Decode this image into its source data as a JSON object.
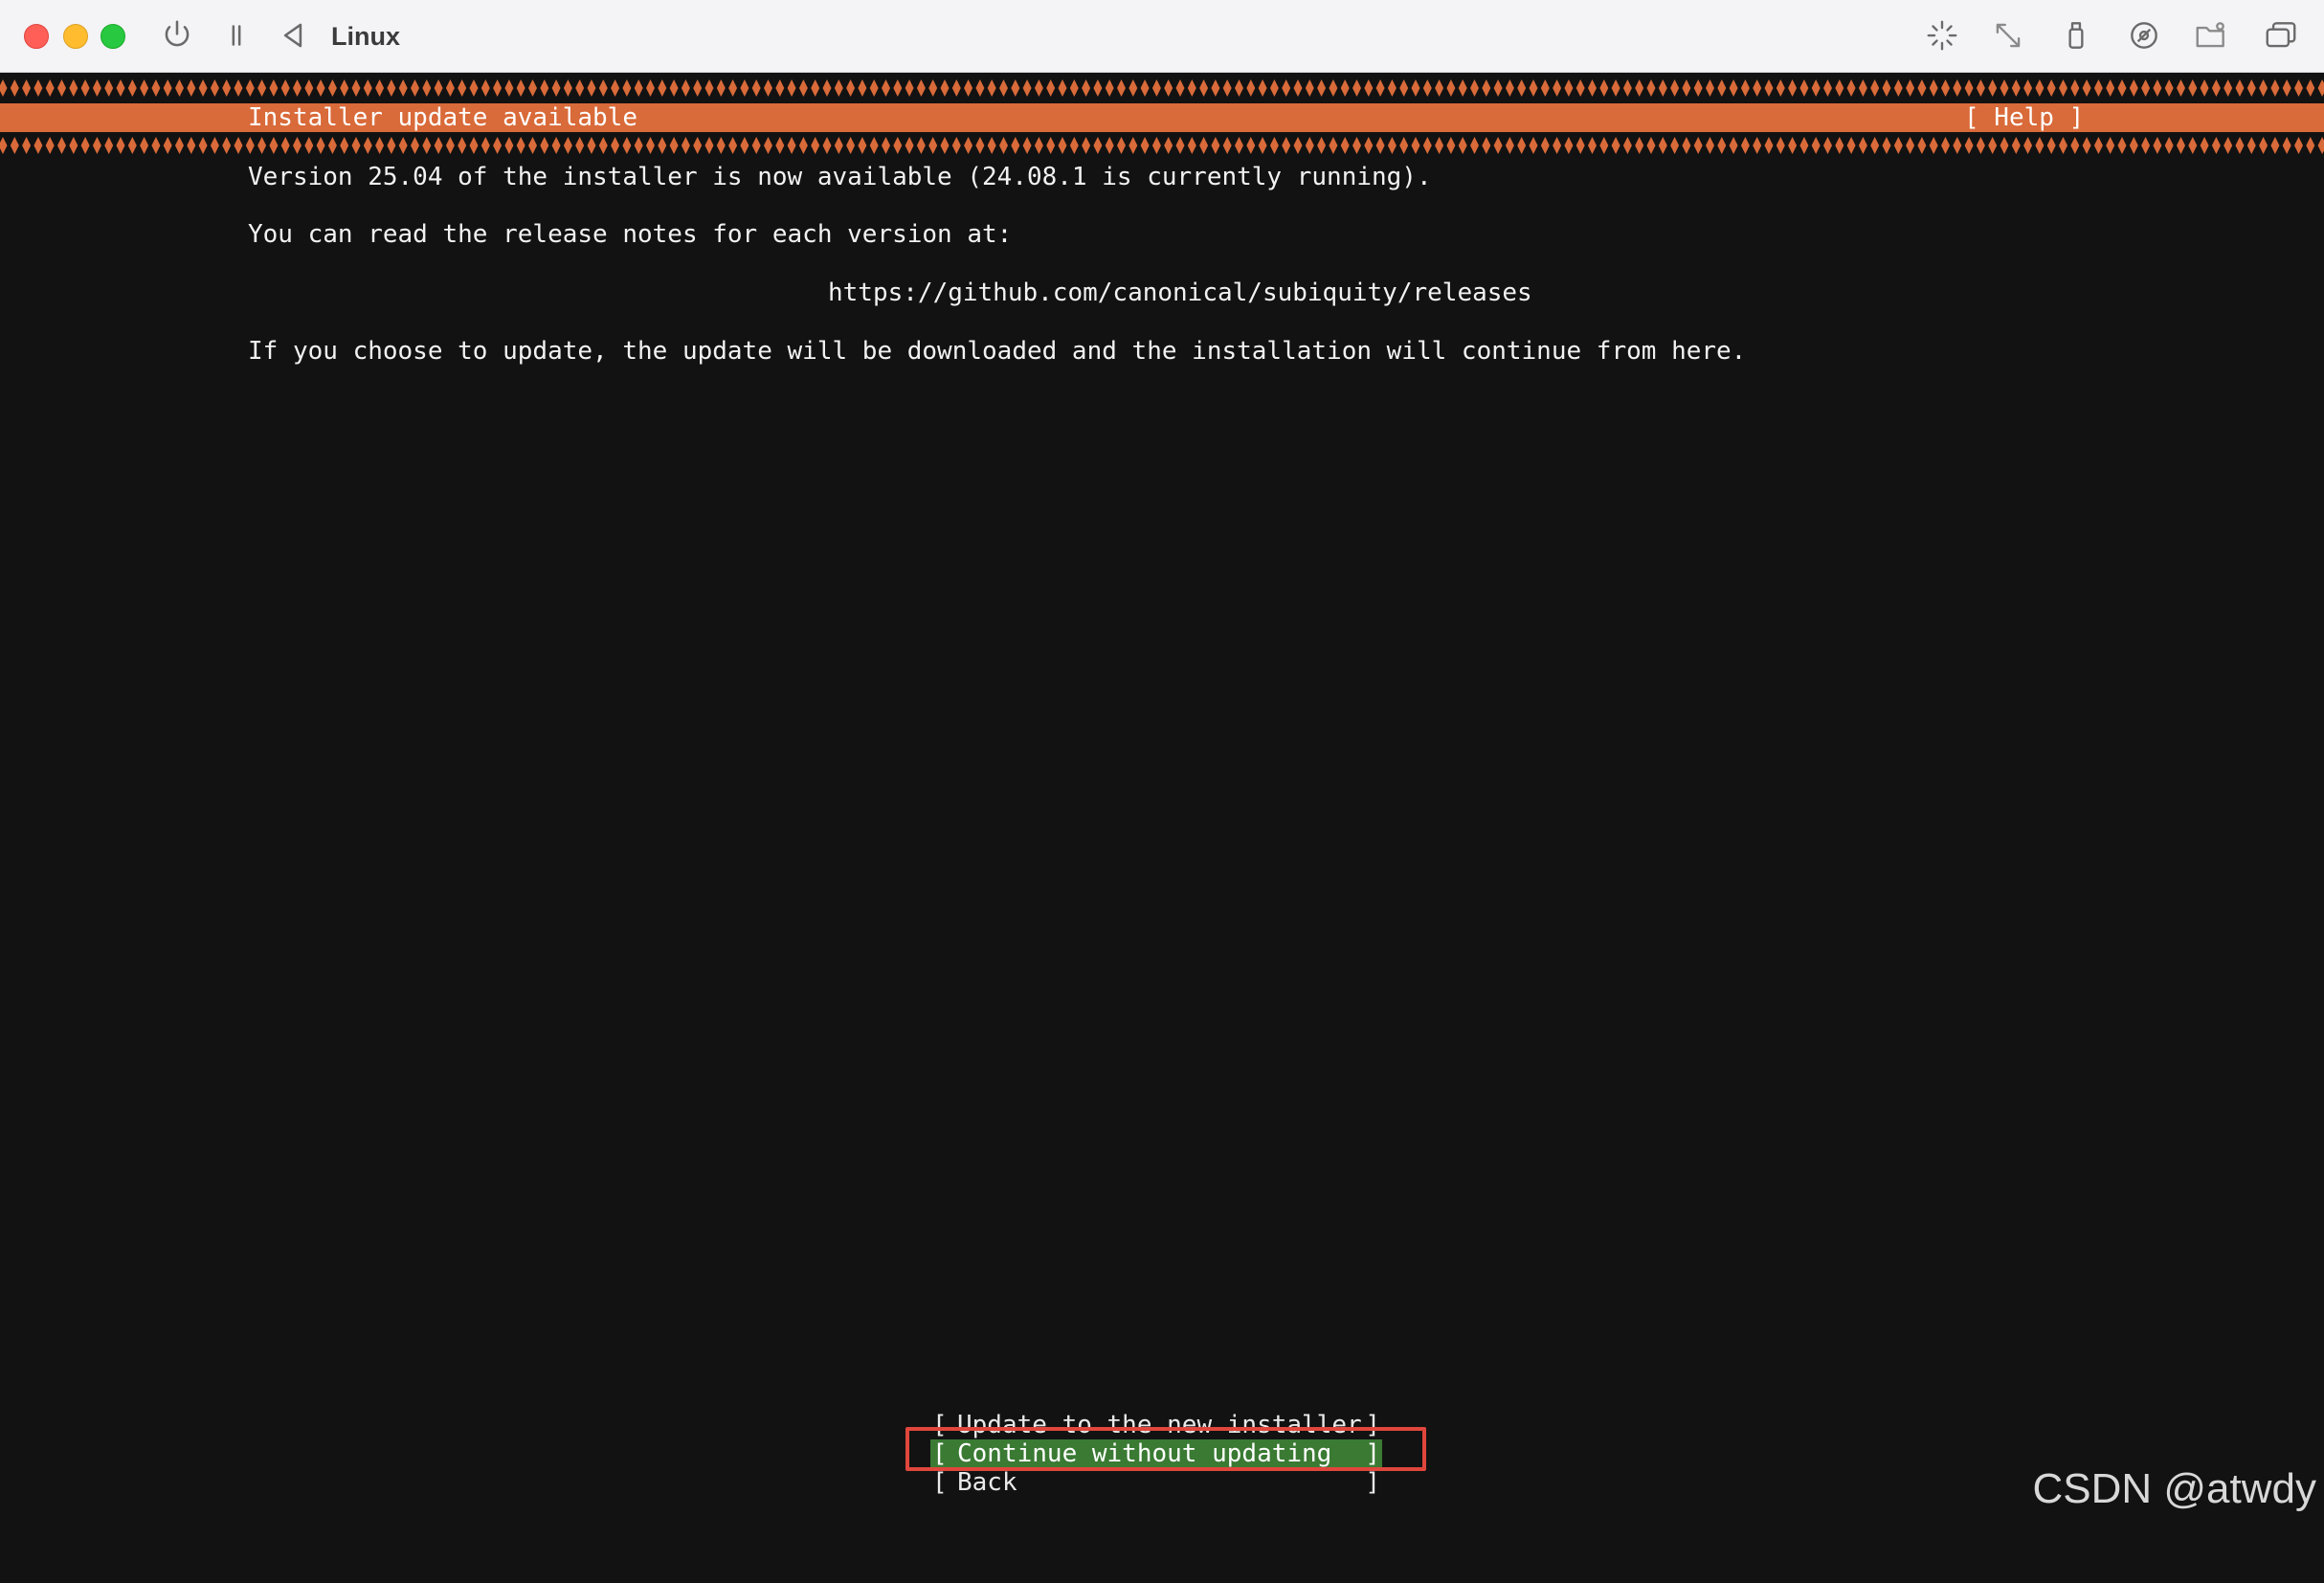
{
  "window": {
    "title": "Linux",
    "toolbar_icons": [
      "power-icon",
      "pause-icon",
      "back-icon",
      "cursor-capture-icon",
      "resize-icon",
      "usb-icon",
      "disc-icon",
      "shared-folder-icon",
      "windows-icon"
    ]
  },
  "installer": {
    "header_title": "Installer update available",
    "help_label": "[ Help ]",
    "lines": [
      "Version 25.04 of the installer is now available (24.08.1 is currently running).",
      "You can read the release notes for each version at:",
      "https://github.com/canonical/subiquity/releases",
      "If you choose to update, the update will be downloaded and the installation will continue from here."
    ],
    "buttons": [
      {
        "label": "Update to the new installer",
        "selected": false
      },
      {
        "label": "Continue without updating",
        "selected": true
      },
      {
        "label": "Back",
        "selected": false
      }
    ],
    "colors": {
      "header": "#d96a39",
      "selected_button": "#3a7a33",
      "annotation_box": "#e0463c",
      "background": "#121212"
    }
  },
  "watermark": "CSDN @atwdy"
}
